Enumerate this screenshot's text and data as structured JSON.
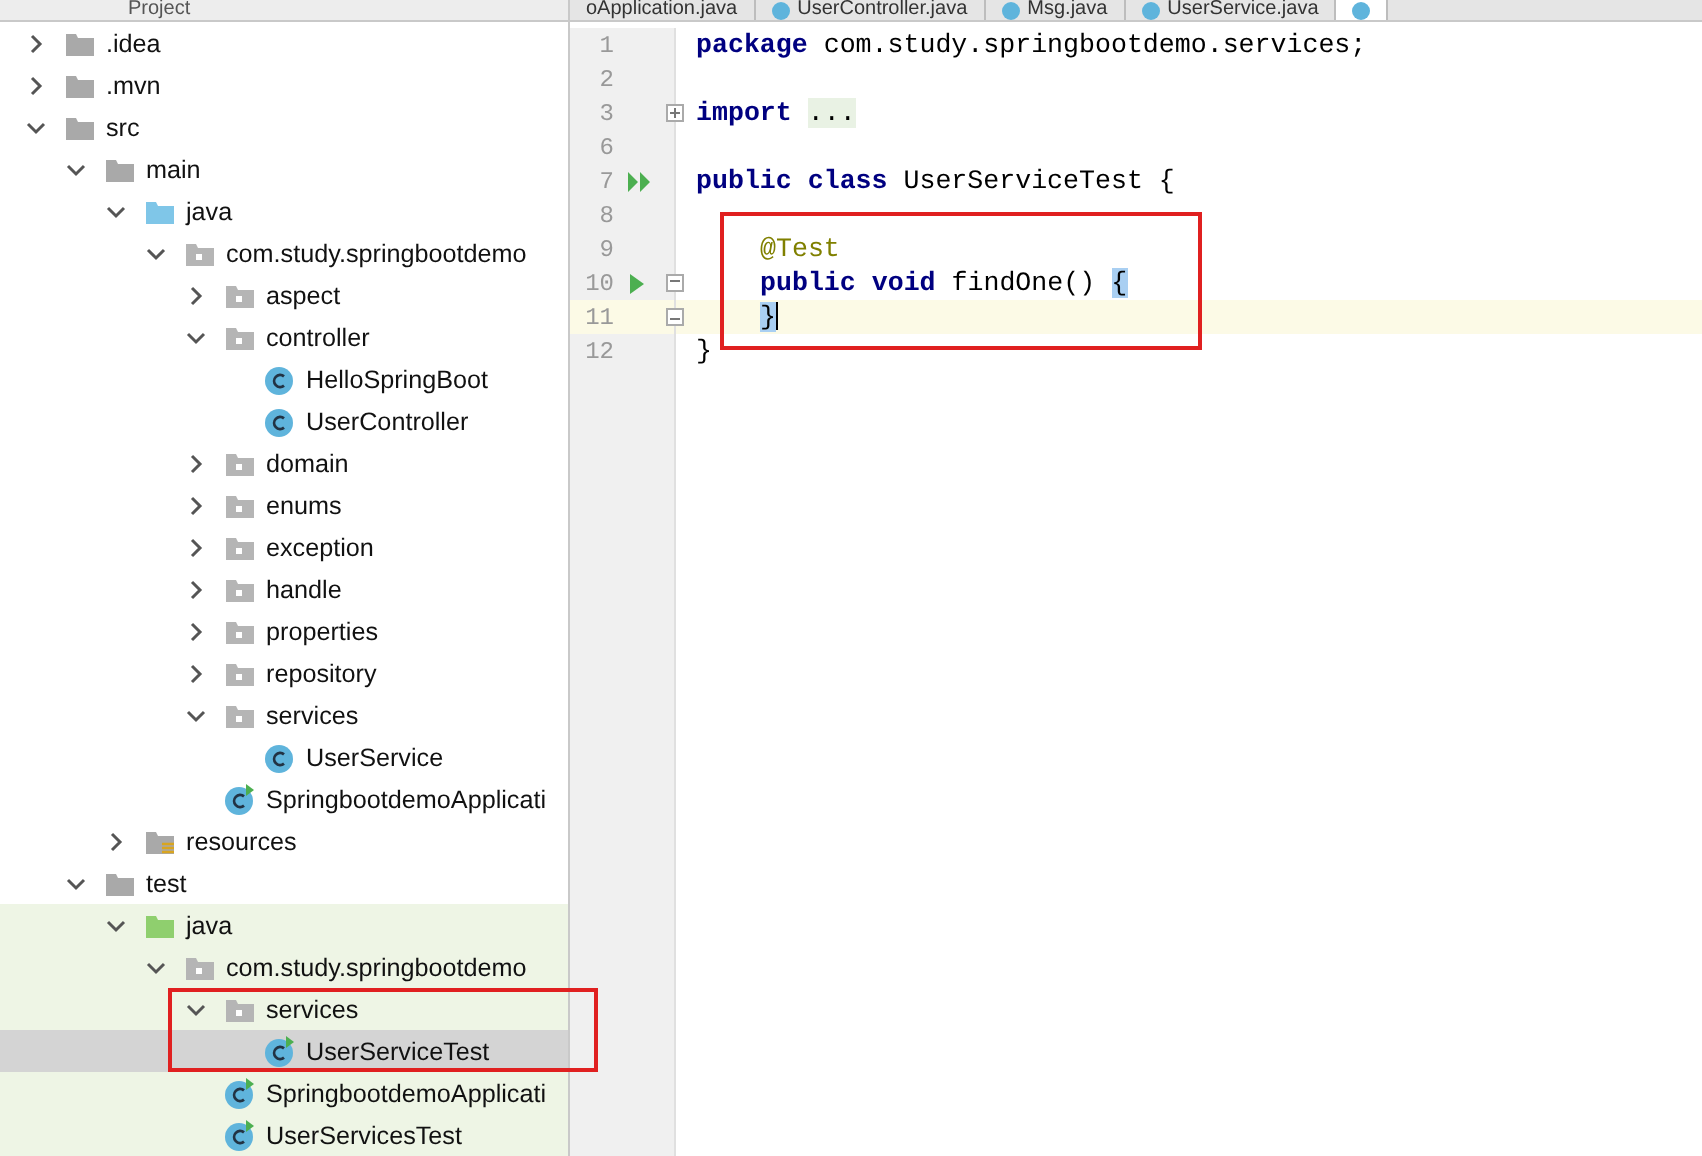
{
  "project_panel": {
    "title": "Project"
  },
  "tree": [
    {
      "label": ".idea",
      "kind": "folder",
      "expanded": false,
      "selected": false
    },
    {
      "label": ".mvn",
      "kind": "folder",
      "expanded": false,
      "selected": false
    },
    {
      "label": "src",
      "kind": "folder",
      "expanded": true,
      "selected": false,
      "children": [
        {
          "label": "main",
          "kind": "folder",
          "expanded": true,
          "selected": false,
          "children": [
            {
              "label": "java",
              "kind": "source-folder",
              "expanded": true,
              "selected": false,
              "children": [
                {
                  "label": "com.study.springbootdemo",
                  "kind": "package",
                  "expanded": true,
                  "selected": false,
                  "children": [
                    {
                      "label": "aspect",
                      "kind": "package",
                      "expanded": false,
                      "selected": false
                    },
                    {
                      "label": "controller",
                      "kind": "package",
                      "expanded": true,
                      "selected": false,
                      "children": [
                        {
                          "label": "HelloSpringBoot",
                          "kind": "class",
                          "selected": false
                        },
                        {
                          "label": "UserController",
                          "kind": "class",
                          "selected": false
                        }
                      ]
                    },
                    {
                      "label": "domain",
                      "kind": "package",
                      "expanded": false,
                      "selected": false
                    },
                    {
                      "label": "enums",
                      "kind": "package",
                      "expanded": false,
                      "selected": false
                    },
                    {
                      "label": "exception",
                      "kind": "package",
                      "expanded": false,
                      "selected": false
                    },
                    {
                      "label": "handle",
                      "kind": "package",
                      "expanded": false,
                      "selected": false
                    },
                    {
                      "label": "properties",
                      "kind": "package",
                      "expanded": false,
                      "selected": false
                    },
                    {
                      "label": "repository",
                      "kind": "package",
                      "expanded": false,
                      "selected": false
                    },
                    {
                      "label": "services",
                      "kind": "package",
                      "expanded": true,
                      "selected": false,
                      "children": [
                        {
                          "label": "UserService",
                          "kind": "class",
                          "selected": false
                        }
                      ]
                    },
                    {
                      "label": "SpringbootdemoApplicati",
                      "kind": "app-class",
                      "selected": false
                    }
                  ]
                }
              ]
            },
            {
              "label": "resources",
              "kind": "resources",
              "expanded": false,
              "selected": false
            }
          ]
        },
        {
          "label": "test",
          "kind": "folder",
          "expanded": true,
          "selected": false,
          "children": [
            {
              "label": "java",
              "kind": "test-folder",
              "expanded": true,
              "selected": false,
              "children": [
                {
                  "label": "com.study.springbootdemo",
                  "kind": "package",
                  "expanded": true,
                  "selected": false,
                  "children": [
                    {
                      "label": "services",
                      "kind": "package",
                      "expanded": true,
                      "selected": false,
                      "children": [
                        {
                          "label": "UserServiceTest",
                          "kind": "test-class",
                          "selected": true
                        }
                      ]
                    },
                    {
                      "label": "SpringbootdemoApplicati",
                      "kind": "test-class",
                      "selected": false
                    },
                    {
                      "label": "UserServicesTest",
                      "kind": "test-class",
                      "selected": false
                    }
                  ]
                }
              ]
            }
          ]
        }
      ]
    }
  ],
  "editor_tabs": [
    {
      "label": "oApplication.java",
      "icon": false,
      "selected": false
    },
    {
      "label": "UserController.java",
      "icon": true,
      "selected": false
    },
    {
      "label": "Msg.java",
      "icon": true,
      "selected": false
    },
    {
      "label": "UserService.java",
      "icon": true,
      "selected": false
    },
    {
      "icon": true,
      "selected": true
    }
  ],
  "code_lines": [
    {
      "number": "1",
      "current": false,
      "tokens": [
        {
          "kind": "keyword",
          "text": "package"
        },
        {
          "kind": "plain",
          "text": " com.study.springbootdemo.services;"
        }
      ]
    },
    {
      "number": "2",
      "current": false
    },
    {
      "number": "3",
      "current": false,
      "fold_marker": {
        "kind": "collapsed"
      },
      "tokens": [
        {
          "kind": "keyword",
          "text": "import"
        },
        {
          "kind": "folded",
          "text": "..."
        }
      ]
    },
    {
      "number": "6",
      "current": false
    },
    {
      "number": "7",
      "current": false,
      "run_marker": {
        "kind": "class"
      },
      "tokens": [
        {
          "kind": "keyword",
          "text": "public class"
        },
        {
          "kind": "plain",
          "text": " UserServiceTest {"
        }
      ]
    },
    {
      "number": "8",
      "current": false
    },
    {
      "number": "9",
      "current": false,
      "indented": true,
      "tokens": [
        {
          "kind": "annotation",
          "text": "@Test"
        }
      ]
    },
    {
      "number": "10",
      "current": false,
      "indented": true,
      "run_marker": {
        "kind": "method"
      },
      "fold_marker": {
        "kind": "start"
      },
      "tokens": [
        {
          "kind": "keyword",
          "text": "public void"
        },
        {
          "kind": "plain",
          "text": " findOne() "
        },
        {
          "kind": "matched-brace",
          "text": "{"
        }
      ]
    },
    {
      "number": "11",
      "current": true,
      "indented": true,
      "fold_marker": {
        "kind": "end"
      },
      "caret": true,
      "tokens": [
        {
          "kind": "matched-brace",
          "text": "}"
        }
      ]
    },
    {
      "number": "12",
      "current": false,
      "tokens": [
        {
          "kind": "plain",
          "text": "}"
        }
      ]
    }
  ]
}
